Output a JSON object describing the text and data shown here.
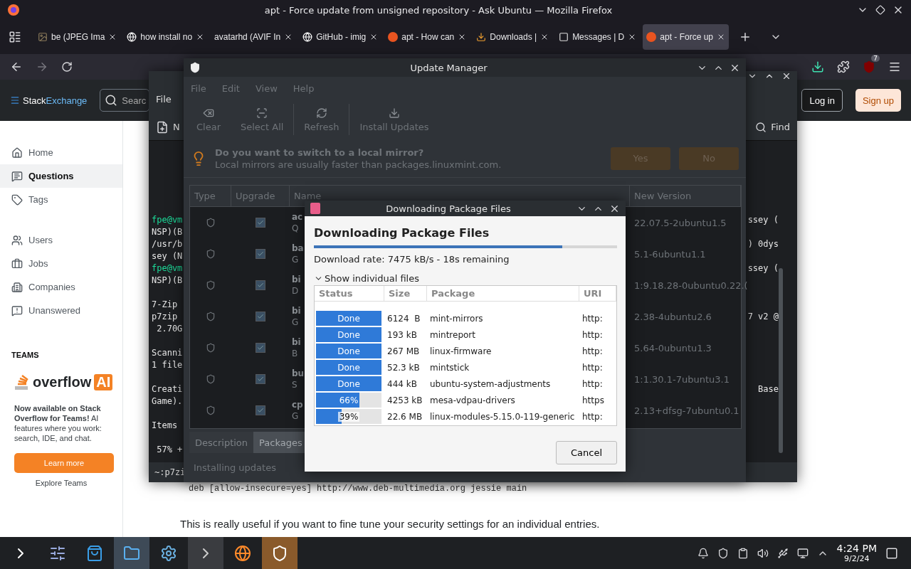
{
  "browser": {
    "title": "apt - Force update from unsigned repository - Ask Ubuntu — Mozilla Firefox",
    "badge": "7",
    "tabs": [
      {
        "label": "be (JPEG Ima",
        "kind": "image",
        "selected": false
      },
      {
        "label": "how install no",
        "kind": "google",
        "selected": false
      },
      {
        "label": "avatarhd (AVIF In",
        "kind": "blank",
        "selected": false
      },
      {
        "label": "GitHub - imig",
        "kind": "github",
        "selected": false
      },
      {
        "label": "apt - How can",
        "kind": "ask",
        "selected": false
      },
      {
        "label": "Downloads |",
        "kind": "downloads",
        "selected": false
      },
      {
        "label": "Messages | D",
        "kind": "messages",
        "selected": false
      },
      {
        "label": "apt - Force up",
        "kind": "ask",
        "selected": true
      }
    ]
  },
  "site": {
    "logo": [
      "Stack",
      "Exchange"
    ],
    "search_placeholder": "Searc",
    "login": "Log in",
    "signup": "Sign up",
    "nav": [
      {
        "label": "Home",
        "kind": "home",
        "selected": false
      },
      {
        "label": "Questions",
        "kind": "questions",
        "selected": true
      },
      {
        "label": "Tags",
        "kind": "tags",
        "selected": false
      },
      {
        "label": "Users",
        "kind": "users",
        "selected": false
      },
      {
        "label": "Jobs",
        "kind": "jobs",
        "selected": false
      },
      {
        "label": "Companies",
        "kind": "companies",
        "selected": false
      },
      {
        "label": "Unanswered",
        "kind": "unanswered",
        "selected": false
      }
    ],
    "teams_heading": "TEAMS",
    "brand": [
      "overflow",
      "AI"
    ],
    "promo": "**Now available on Stack Overflow for Teams!** AI features where you work: search, IDE, and chat.",
    "learn_more": "Learn more",
    "explore": "Explore Teams",
    "code_line": "deb [allow-insecure=yes] http://www.deb-multimedia.org jessie main",
    "paragraph": "This is really useful if you want to fine tune your security settings for an individual entries."
  },
  "terminal": {
    "menu": "File",
    "new_tab": "N",
    "find": "Find",
    "status": "~:p7zi",
    "lines": [
      {
        "left": "fpe@vm",
        "right": "ssey (",
        "prompt": true
      },
      {
        "left": "NSP)(B",
        "prompt": false
      },
      {
        "left": "/usr/b",
        "right": ") 0dys",
        "prompt": false
      },
      {
        "left": "sey (N",
        "prompt": false
      },
      {
        "left": "fpe@vm",
        "right": "ssey (",
        "prompt": true
      },
      {
        "left": "NSP)(B",
        "prompt": false
      },
      {
        "prompt": false
      },
      {
        "left": "7-Zip",
        "prompt": false
      },
      {
        "left": "p7zip",
        "right": "7 v2 @",
        "prompt": false
      },
      {
        "left": " 2.70G",
        "prompt": false
      },
      {
        "prompt": false
      },
      {
        "left": "Scanni",
        "prompt": false
      },
      {
        "left": "1 file",
        "prompt": false
      },
      {
        "prompt": false
      },
      {
        "left": "Creati",
        "right": "Base",
        "prompt": false
      },
      {
        "left": "Game).",
        "prompt": false
      },
      {
        "prompt": false
      },
      {
        "left": "Items",
        "prompt": false
      },
      {
        "prompt": false
      },
      {
        "left": " 57% +",
        "prompt": false
      }
    ]
  },
  "update_manager": {
    "title": "Update Manager",
    "menu": [
      "File",
      "Edit",
      "View",
      "Help"
    ],
    "toolbar": [
      {
        "label": "Clear",
        "kind": "clear"
      },
      {
        "label": "Select All",
        "kind": "select"
      },
      {
        "label": "Refresh",
        "kind": "refresh"
      },
      {
        "label": "Install Updates",
        "kind": "install"
      }
    ],
    "infobar": {
      "title": "Do you want to switch to a local mirror?",
      "text": "Local mirrors are usually faster than packages.linuxmint.com.",
      "buttons": [
        "Yes",
        "No"
      ]
    },
    "columns": [
      "Type",
      "Upgrade",
      "Name",
      "New Version"
    ],
    "rows": [
      {
        "name": "ac",
        "desc": "Q",
        "checked": true,
        "version": "22.07.5-2ubuntu1.5"
      },
      {
        "name": "ba",
        "desc": "G",
        "checked": true,
        "version": "5.1-6ubuntu1.1"
      },
      {
        "name": "bi",
        "desc": "D",
        "checked": true,
        "version": "1:9.18.28-0ubuntu0.22.("
      },
      {
        "name": "bi",
        "desc": "G",
        "checked": true,
        "version": "2.38-4ubuntu2.6"
      },
      {
        "name": "bi",
        "desc": "B",
        "checked": true,
        "version": "5.64-0ubuntu1.3"
      },
      {
        "name": "bu",
        "desc": "S",
        "checked": true,
        "version": "1:1.30.1-7ubuntu3.1"
      },
      {
        "name": "cp",
        "desc": "G",
        "checked": true,
        "version": "2.13+dfsg-7ubuntu0.1"
      }
    ],
    "bottom_tabs": [
      {
        "label": "Description",
        "selected": false
      },
      {
        "label": "Packages",
        "selected": true
      }
    ],
    "status": "Installing updates"
  },
  "dialog": {
    "title": "Downloading Package Files",
    "heading": "Downloading Package Files",
    "level": 0.82,
    "rate": "Download rate: 7475 kB/s - 18s remaining",
    "expander": "Show individual files",
    "expanded": true,
    "columns": [
      "Status",
      "Size",
      "Package",
      "URI"
    ],
    "rows": [
      {
        "status": "Done",
        "level": 1,
        "size": "6124  B",
        "package": "mint-mirrors",
        "uri": "http:"
      },
      {
        "status": "Done",
        "level": 1,
        "size": "193 kB",
        "package": "mintreport",
        "uri": "http:"
      },
      {
        "status": "Done",
        "level": 1,
        "size": "267 MB",
        "package": "linux-firmware",
        "uri": "http:"
      },
      {
        "status": "Done",
        "level": 1,
        "size": "52.3 kB",
        "package": "mintstick",
        "uri": "http:"
      },
      {
        "status": "Done",
        "level": 1,
        "size": "444 kB",
        "package": "ubuntu-system-adjustments",
        "uri": "http:"
      },
      {
        "status": "66%",
        "level": 0.66,
        "size": "4253 kB",
        "package": "mesa-vdpau-drivers",
        "uri": "https"
      },
      {
        "status": "39%",
        "level": 0.39,
        "size": "22.6 MB",
        "package": "linux-modules-5.15.0-119-generic",
        "uri": "http:"
      }
    ],
    "cancel": "Cancel"
  },
  "taskbar": {
    "apps": [
      {
        "kind": "launcher",
        "open": false
      },
      {
        "kind": "mixer",
        "open": false
      },
      {
        "kind": "store",
        "open": false
      },
      {
        "kind": "files",
        "open": true
      },
      {
        "kind": "settings",
        "open": false
      },
      {
        "kind": "terminal",
        "open": true
      },
      {
        "kind": "firefox",
        "open": false
      },
      {
        "kind": "shield",
        "open": true
      }
    ],
    "time": "4:24 PM",
    "date": "9/2/24"
  }
}
